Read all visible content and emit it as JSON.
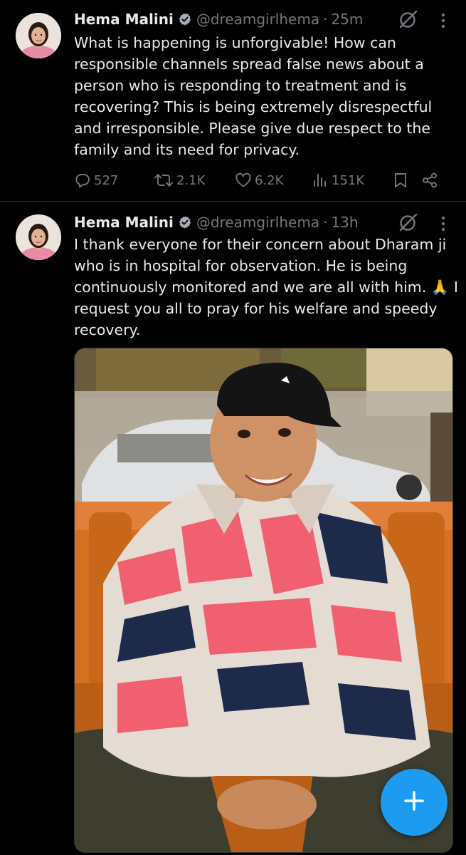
{
  "colors": {
    "background": "#000000",
    "text": "#e7e9ea",
    "muted": "#71767b",
    "accent": "#1d9bf0",
    "divider": "#2f3336"
  },
  "tweets": [
    {
      "author_name": "Hema Malini",
      "handle": "@dreamgirlhema",
      "separator": "·",
      "time": "25m",
      "text_lines": [
        "What is happening is unforgivable! How can",
        "responsible channels spread false news about a",
        "person who is responding to treatment and is",
        "recovering? This is being extremely disrespectful",
        "and  irresponsible. Please give due respect to the",
        "family and its need for privacy."
      ],
      "replies": "527",
      "reposts": "2.1K",
      "likes": "6.2K",
      "views": "151K"
    },
    {
      "author_name": "Hema Malini",
      "handle": "@dreamgirlhema",
      "separator": "·",
      "time": "13h",
      "text_lines": [
        "I thank everyone for their concern about Dharam ji",
        "who is in hospital for observation. He is being",
        "continuously monitored and we are all with him. 🙏 I",
        "request you all to pray for his welfare and speedy",
        "recovery."
      ]
    }
  ],
  "icons": {
    "verified": "verified-badge-icon",
    "grok": "grok-icon",
    "more": "more-vertical-icon",
    "reply": "reply-icon",
    "repost": "repost-icon",
    "like": "like-icon",
    "views": "views-icon",
    "bookmark": "bookmark-icon",
    "share": "share-icon",
    "compose": "plus-icon"
  }
}
